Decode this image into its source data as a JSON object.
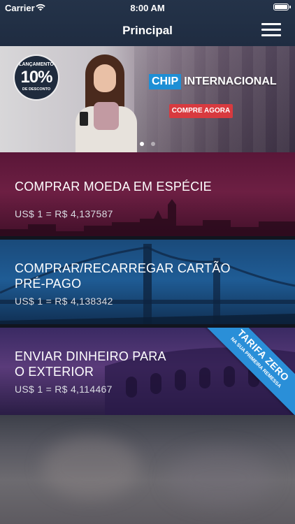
{
  "status_bar": {
    "carrier": "Carrier",
    "time": "8:00 AM"
  },
  "nav": {
    "title": "Principal",
    "menu_icon": "hamburger-menu-icon"
  },
  "banner": {
    "badge_line1": "LANÇAMENTO",
    "badge_line2": "10%",
    "badge_line3": "DE DESCONTO",
    "logo_chip": "CHIP",
    "logo_international": "INTERNACIONAL",
    "cta": "COMPRE AGORA",
    "pagination_total": 2,
    "pagination_active": 1
  },
  "cards": [
    {
      "title": "COMPRAR MOEDA EM ESPÉCIE",
      "rate": "US$ 1 = R$  4,137587"
    },
    {
      "title": "COMPRAR/RECARREGAR CARTÃO PRÉ-PAGO",
      "rate": "US$ 1 = R$  4,138342"
    },
    {
      "title": "ENVIAR DINHEIRO PARA O EXTERIOR",
      "rate": "US$ 1 = R$  4,114467",
      "ribbon_line1": "TARIFA ZERO",
      "ribbon_line2": "NA SUA PRIMEIRA REMESSA"
    }
  ],
  "colors": {
    "nav_bg": "#243349",
    "chip_blue": "#1e8fd5",
    "cta_red": "#d83a3f",
    "ribbon_blue": "#2a8fd8"
  }
}
